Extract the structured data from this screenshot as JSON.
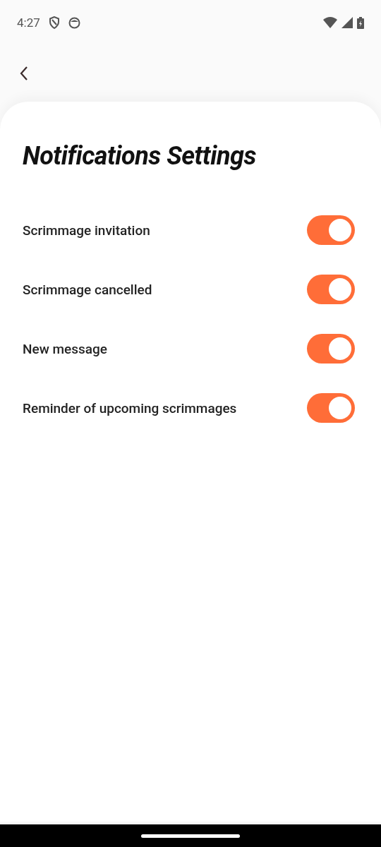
{
  "status_bar": {
    "time": "4:27"
  },
  "title": "Notifications Settings",
  "settings": [
    {
      "label": "Scrimmage invitation",
      "on": true
    },
    {
      "label": "Scrimmage cancelled",
      "on": true
    },
    {
      "label": "New message",
      "on": true
    },
    {
      "label": "Reminder of upcoming scrimmages",
      "on": true
    }
  ]
}
